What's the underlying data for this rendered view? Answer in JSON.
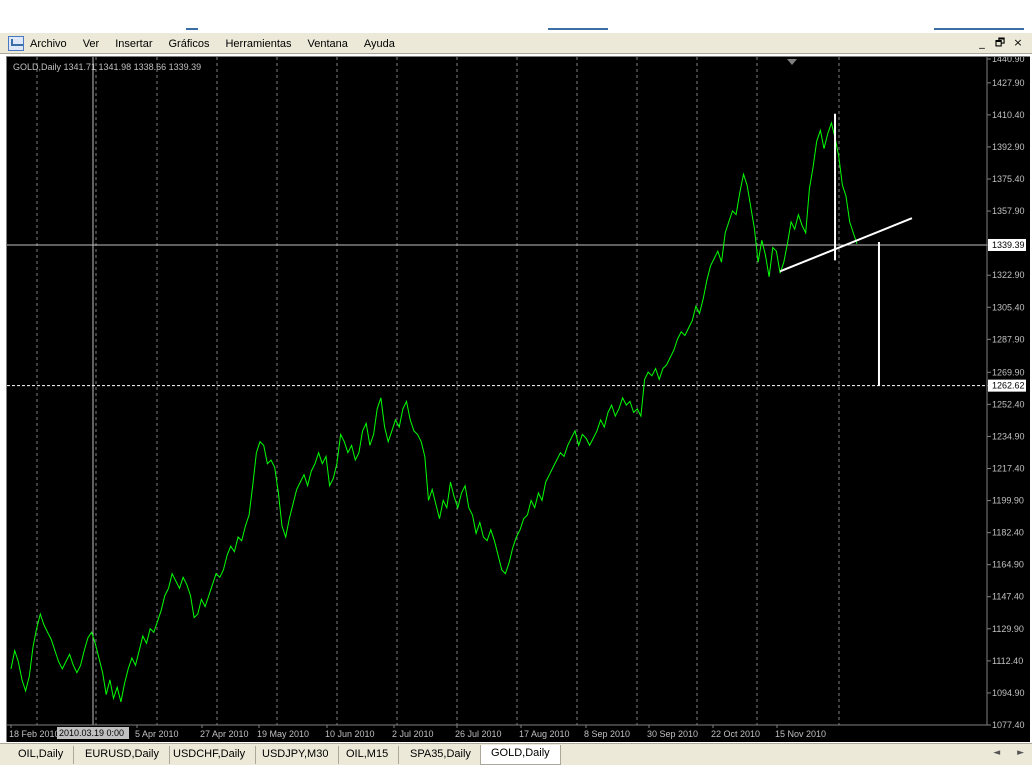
{
  "menu": {
    "items": [
      "Archivo",
      "Ver",
      "Insertar",
      "Gráficos",
      "Herramientas",
      "Ventana",
      "Ayuda"
    ],
    "window_controls": [
      "_",
      "🗗",
      "×"
    ]
  },
  "chart": {
    "info_label": "GOLD,Daily  1341.71 1341.98 1338.66 1339.39",
    "current_price_label": "1339.39",
    "target_price_label": "1262.62",
    "crosshair_date_label": "2010.03.19 0:00",
    "colors": {
      "background": "#000000",
      "line": "#00ff00",
      "grid": "#808080",
      "axis_text": "#c0c0c0",
      "drawing": "#ffffff"
    }
  },
  "chart_data": {
    "type": "line",
    "symbol": "GOLD",
    "timeframe": "Daily",
    "ohlc_last": {
      "open": 1341.71,
      "high": 1341.98,
      "low": 1338.66,
      "close": 1339.39
    },
    "y_ticks": [
      "1440.90",
      "1427.90",
      "1410.40",
      "1392.90",
      "1375.40",
      "1357.90",
      "1339.39",
      "1322.90",
      "1305.40",
      "1287.90",
      "1269.90",
      "1262.62",
      "1252.40",
      "1234.90",
      "1217.40",
      "1199.90",
      "1182.40",
      "1164.90",
      "1147.40",
      "1129.90",
      "1112.40",
      "1094.90",
      "1077.40"
    ],
    "x_ticks": [
      "18 Feb 2010",
      "5 Apr 2010",
      "27 Apr 2010",
      "19 May 2010",
      "10 Jun 2010",
      "2 Jul 2010",
      "26 Jul 2010",
      "17 Aug 2010",
      "8 Sep 2010",
      "30 Sep 2010",
      "22 Oct 2010",
      "15 Nov 2010"
    ],
    "ylim": [
      1077.4,
      1440.9
    ],
    "series": [
      {
        "values": [
          1108,
          1118,
          1112,
          1102,
          1096,
          1104,
          1120,
          1130,
          1138,
          1132,
          1128,
          1124,
          1118,
          1112,
          1108,
          1112,
          1116,
          1110,
          1106,
          1110,
          1118,
          1125,
          1128,
          1122,
          1114,
          1106,
          1094,
          1102,
          1092,
          1098,
          1090,
          1100,
          1108,
          1114,
          1110,
          1118,
          1126,
          1122,
          1130,
          1128,
          1134,
          1140,
          1148,
          1152,
          1160,
          1156,
          1152,
          1158,
          1154,
          1148,
          1136,
          1138,
          1146,
          1142,
          1148,
          1154,
          1160,
          1158,
          1162,
          1170,
          1175,
          1172,
          1180,
          1178,
          1186,
          1192,
          1208,
          1226,
          1232,
          1230,
          1220,
          1222,
          1218,
          1204,
          1186,
          1180,
          1190,
          1198,
          1206,
          1210,
          1214,
          1208,
          1216,
          1220,
          1226,
          1220,
          1224,
          1208,
          1212,
          1220,
          1236,
          1232,
          1226,
          1230,
          1222,
          1226,
          1238,
          1242,
          1230,
          1236,
          1250,
          1256,
          1240,
          1232,
          1238,
          1244,
          1240,
          1250,
          1254,
          1244,
          1238,
          1236,
          1232,
          1224,
          1200,
          1206,
          1198,
          1190,
          1200,
          1196,
          1210,
          1202,
          1196,
          1204,
          1208,
          1196,
          1192,
          1182,
          1188,
          1180,
          1178,
          1184,
          1178,
          1170,
          1162,
          1160,
          1166,
          1174,
          1180,
          1184,
          1190,
          1192,
          1200,
          1196,
          1204,
          1200,
          1210,
          1214,
          1218,
          1222,
          1226,
          1224,
          1230,
          1234,
          1238,
          1230,
          1236,
          1234,
          1230,
          1234,
          1238,
          1244,
          1240,
          1248,
          1252,
          1246,
          1250,
          1256,
          1252,
          1254,
          1248,
          1250,
          1246,
          1266,
          1270,
          1268,
          1272,
          1266,
          1272,
          1274,
          1278,
          1282,
          1288,
          1292,
          1290,
          1294,
          1298,
          1306,
          1302,
          1310,
          1320,
          1328,
          1332,
          1336,
          1330,
          1346,
          1352,
          1358,
          1356,
          1368,
          1378,
          1372,
          1360,
          1348,
          1330,
          1342,
          1334,
          1322,
          1338,
          1336,
          1324,
          1330,
          1340,
          1352,
          1348,
          1356,
          1350,
          1346,
          1370,
          1382,
          1396,
          1402,
          1392,
          1400,
          1406,
          1398,
          1388,
          1372,
          1366,
          1352,
          1346,
          1340
        ]
      }
    ],
    "annotations": {
      "current_price": 1339.39,
      "target_price": 1262.62,
      "trendline": {
        "from": {
          "x_index": 210,
          "y": 1325
        },
        "to": {
          "x_index": 246,
          "y": 1354
        }
      },
      "head_height_line": {
        "x_index": 225,
        "y_top": 1411,
        "y_bottom": 1331
      },
      "projection_line": {
        "x_index": 237,
        "y_top": 1341,
        "y_bottom": 1262.62
      },
      "crosshair": {
        "x_label": "2010.03.19 0:00",
        "y": 1339.39
      }
    }
  },
  "tabs": {
    "items": [
      "OIL,Daily",
      "EURUSD,Daily",
      "USDCHF,Daily",
      "USDJPY,M30",
      "OIL,M15",
      "SPA35,Daily",
      "GOLD,Daily"
    ],
    "active_index": 6,
    "scroll": [
      "◄",
      "►"
    ]
  }
}
